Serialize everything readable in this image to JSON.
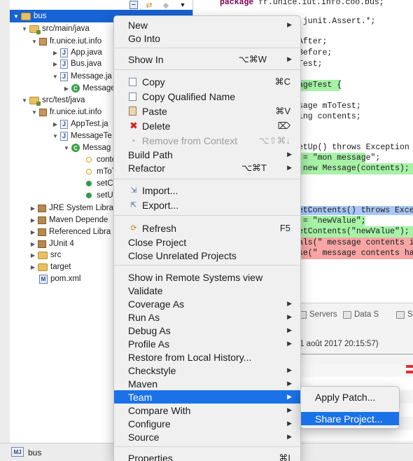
{
  "explorer": {
    "rows": [
      {
        "label": "bus"
      },
      {
        "label": "src/main/java"
      },
      {
        "label": "fr.unice.iut.info"
      },
      {
        "label": "App.java"
      },
      {
        "label": "Bus.java"
      },
      {
        "label": "Message.ja"
      },
      {
        "label": "Message"
      },
      {
        "label": "src/test/java"
      },
      {
        "label": "fr.unice.iut.info"
      },
      {
        "label": "AppTest.ja"
      },
      {
        "label": "MessageTe"
      },
      {
        "label": "Messag"
      },
      {
        "label": "conte"
      },
      {
        "label": "mToT"
      },
      {
        "label": "setCo"
      },
      {
        "label": "setUp"
      },
      {
        "label": "JRE System Libra"
      },
      {
        "label": "Maven Depende"
      },
      {
        "label": "Referenced Libra"
      },
      {
        "label": "JUnit 4"
      },
      {
        "label": "src"
      },
      {
        "label": "target"
      },
      {
        "label": "pom.xml"
      }
    ]
  },
  "editor": {
    "lines": [
      {
        "t1": "package ",
        "t2": "fr.unice.iut.info.coo.bus;"
      },
      {
        "t1": "",
        "t2": ".junit.Assert.*;"
      },
      {
        "t1": "",
        "t2": "After;"
      },
      {
        "t1": "",
        "t2": "Before;"
      },
      {
        "t1": "",
        "t2": "Test;"
      },
      {
        "t1": "",
        "t2": "ageTest {"
      },
      {
        "t1": "",
        "t2": "sage mToTest;"
      },
      {
        "t1": "",
        "t2": "ing contents;"
      },
      {
        "t1": "",
        "t2": "etUp() throws Exception {"
      },
      {
        "t1": "",
        "t2": " = \"mon message\";"
      },
      {
        "t1": "",
        "t2": " new Message(contents);"
      },
      {
        "t1": "",
        "t2": "etContents() throws Excep"
      },
      {
        "t1": "",
        "t2": " = \"newValue\";"
      },
      {
        "t1": "",
        "t2": "etContents(\"newValue\");"
      },
      {
        "t1": "",
        "t2": "als(\" message contents is"
      },
      {
        "t1": "",
        "t2": "se(\" message contents has"
      }
    ]
  },
  "views": {
    "tabs": [
      {
        "label": "Servers"
      },
      {
        "label": "Data S"
      },
      {
        "label": "Sn"
      }
    ],
    "console_date": "1 août 2017 20:15:57)"
  },
  "statusbar": {
    "text": "bus"
  },
  "context_menu": {
    "items": [
      {
        "label": "New"
      },
      {
        "label": "Go Into"
      },
      {
        "label": "Show In",
        "shortcut": "⌥⌘W"
      },
      {
        "label": "Copy",
        "shortcut": "⌘C"
      },
      {
        "label": "Copy Qualified Name"
      },
      {
        "label": "Paste",
        "shortcut": "⌘V"
      },
      {
        "label": "Delete",
        "shortcut": "⌦"
      },
      {
        "label": "Remove from Context",
        "shortcut": "⌥⇧⌘↓"
      },
      {
        "label": "Build Path"
      },
      {
        "label": "Refactor",
        "shortcut": "⌥⌘T"
      },
      {
        "label": "Import..."
      },
      {
        "label": "Export..."
      },
      {
        "label": "Refresh",
        "shortcut": "F5"
      },
      {
        "label": "Close Project"
      },
      {
        "label": "Close Unrelated Projects"
      },
      {
        "label": "Show in Remote Systems view"
      },
      {
        "label": "Validate"
      },
      {
        "label": "Coverage As"
      },
      {
        "label": "Run As"
      },
      {
        "label": "Debug As"
      },
      {
        "label": "Profile As"
      },
      {
        "label": "Restore from Local History..."
      },
      {
        "label": "Checkstyle"
      },
      {
        "label": "Maven"
      },
      {
        "label": "Team"
      },
      {
        "label": "Compare With"
      },
      {
        "label": "Configure"
      },
      {
        "label": "Source"
      },
      {
        "label": "Properties",
        "shortcut": "⌘I"
      }
    ]
  },
  "team_submenu": {
    "items": [
      {
        "label": "Apply Patch..."
      },
      {
        "label": "Share Project..."
      }
    ]
  },
  "colors": {
    "selection": "#1763d3",
    "menu_active": "#1b72e8",
    "highlight_green": "#a7f2a7",
    "highlight_red": "#f7a5a5",
    "highlight_blue": "#a9c8f5"
  }
}
